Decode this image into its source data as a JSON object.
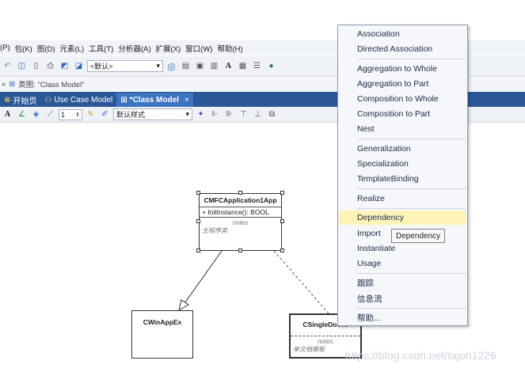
{
  "menubar": {
    "items": [
      "(P)",
      "包(K)",
      "图(D)",
      "元素(L)",
      "工具(T)",
      "分析器(A)",
      "扩展(X)",
      "窗口(W)",
      "帮助(H)"
    ]
  },
  "toolbar": {
    "style_combo": "<默认>",
    "icons": [
      "undo-icon",
      "find-icon",
      "document-icon",
      "print-icon",
      "preview-icon",
      "search-icon",
      "help-icon",
      "save-icon",
      "image-icon",
      "page-icon",
      "font-icon",
      "list-icon",
      "table-icon",
      "palette-icon"
    ]
  },
  "path": {
    "icon": "diagram-icon",
    "text": "类图: \"Class Model\""
  },
  "tabs": [
    {
      "label": "开始页",
      "icon": "start-icon",
      "active": false
    },
    {
      "label": "Use Case Model",
      "icon": "usecase-icon",
      "active": false
    },
    {
      "label": "*Class Model",
      "icon": "class-diagram-icon",
      "active": true,
      "close": "×"
    }
  ],
  "diagram_toolbar": {
    "line_width": "1",
    "style_combo": "默认样式"
  },
  "diagram": {
    "classes": [
      {
        "name": "CMFCApplication1App",
        "operations": [
          "+   InitInstance(): BOOL"
        ],
        "notes_label": "notes",
        "notes_text": "主程序类"
      },
      {
        "name": "CWinAppEx"
      },
      {
        "name": "CSingleDocTe",
        "notes_label": "notes",
        "notes_text": "单文档模板"
      }
    ]
  },
  "context_menu": {
    "items": [
      "Association",
      "Directed Association",
      "Aggregation to Whole",
      "Aggregation to Part",
      "Composition to Whole",
      "Composition to Part",
      "Nest",
      "Generalization",
      "Specialization",
      "TemplateBinding",
      "Realize",
      "Dependency",
      "Import",
      "Instantiate",
      "Usage",
      "跟踪",
      "信息流",
      "帮助..."
    ],
    "highlighted": "Dependency"
  },
  "tooltip": "Dependency",
  "watermark": "https://blog.csdn.net/tajon1226",
  "colors": {
    "tab_bar": "#2b5797",
    "highlight": "#fff3b8",
    "menu_bg": "#f5f7fb"
  }
}
